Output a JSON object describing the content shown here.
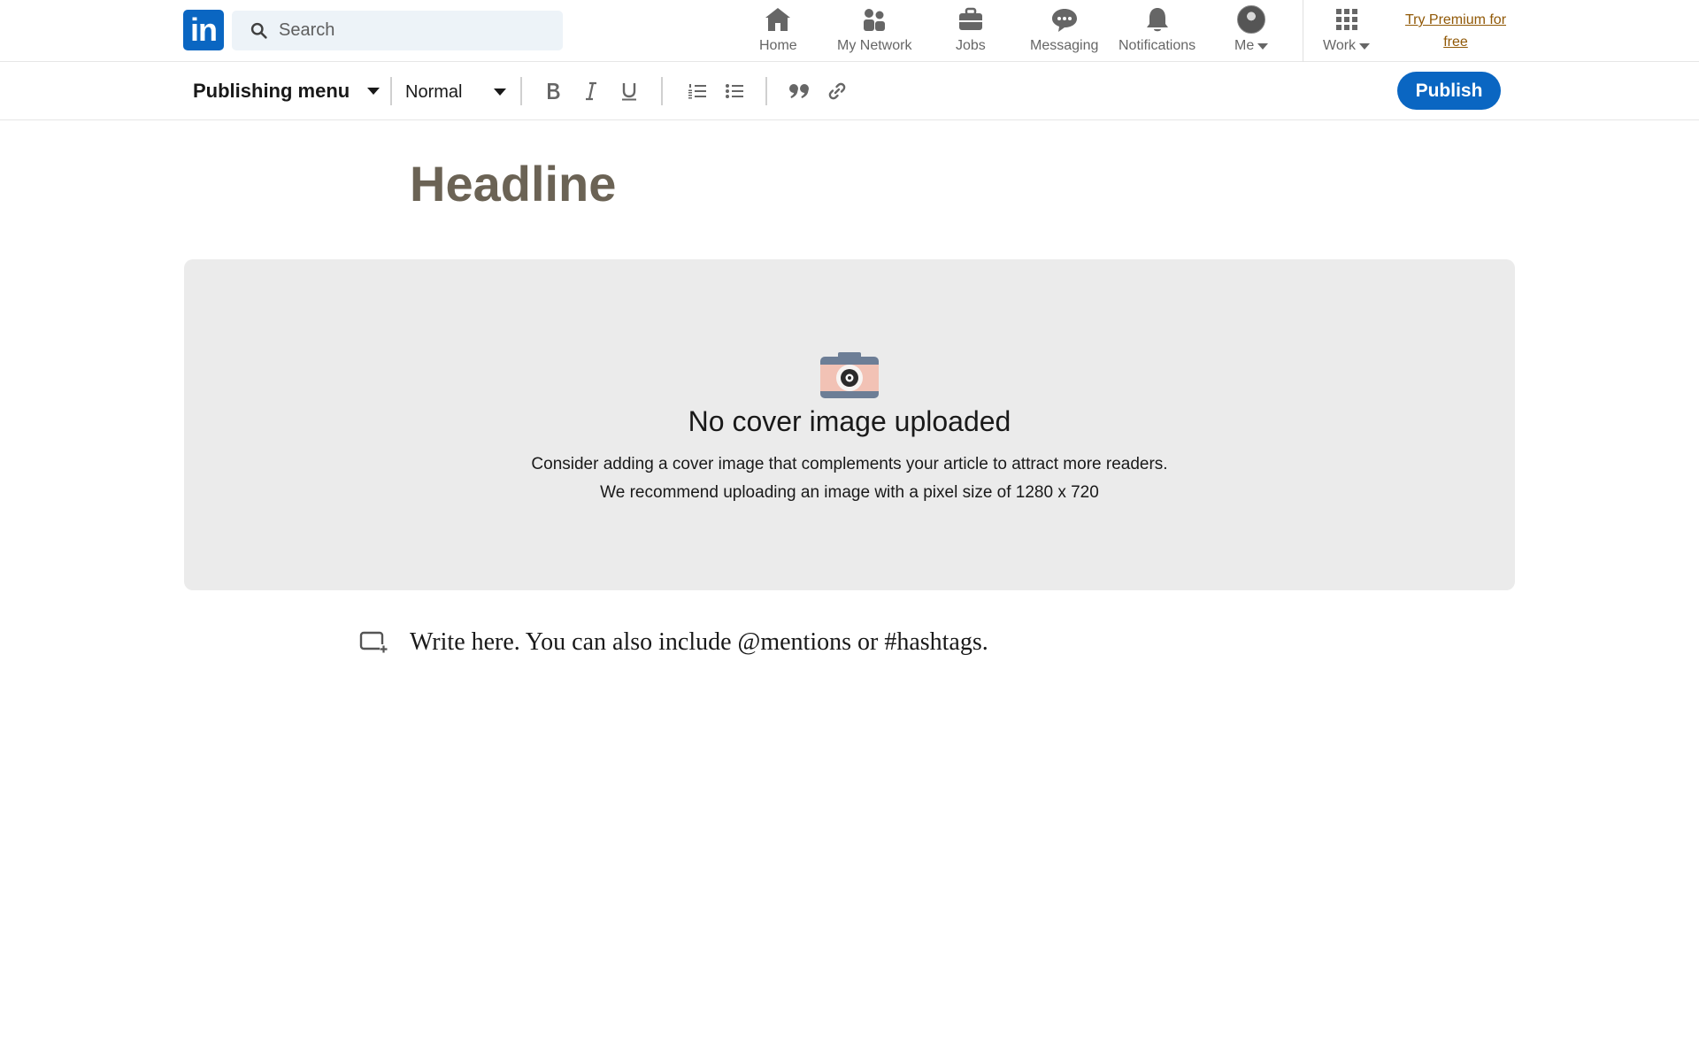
{
  "nav": {
    "logo_text": "in",
    "search_placeholder": "Search",
    "items": [
      {
        "label": "Home",
        "icon": "home-icon"
      },
      {
        "label": "My Network",
        "icon": "network-icon"
      },
      {
        "label": "Jobs",
        "icon": "briefcase-icon"
      },
      {
        "label": "Messaging",
        "icon": "messaging-icon"
      },
      {
        "label": "Notifications",
        "icon": "bell-icon"
      },
      {
        "label": "Me",
        "icon": "avatar"
      },
      {
        "label": "Work",
        "icon": "grid-icon"
      }
    ],
    "premium_link": "Try Premium for free"
  },
  "toolbar": {
    "publishing_menu": "Publishing menu",
    "text_style": "Normal",
    "buttons": [
      "bold-icon",
      "italic-icon",
      "underline-icon",
      "numbered-list-icon",
      "bulleted-list-icon",
      "quote-icon",
      "link-icon"
    ],
    "publish_label": "Publish"
  },
  "editor": {
    "headline_placeholder": "Headline",
    "cover": {
      "title": "No cover image uploaded",
      "line1": "Consider adding a cover image that complements your article to attract more readers.",
      "line2": "We recommend uploading an image with a pixel size of 1280 x 720"
    },
    "body_placeholder": "Write here. You can also include @mentions or #hashtags."
  },
  "colors": {
    "brand": "#0a66c2",
    "premium": "#915907",
    "headline": "#6b6355",
    "cover_bg": "#ebebeb"
  }
}
